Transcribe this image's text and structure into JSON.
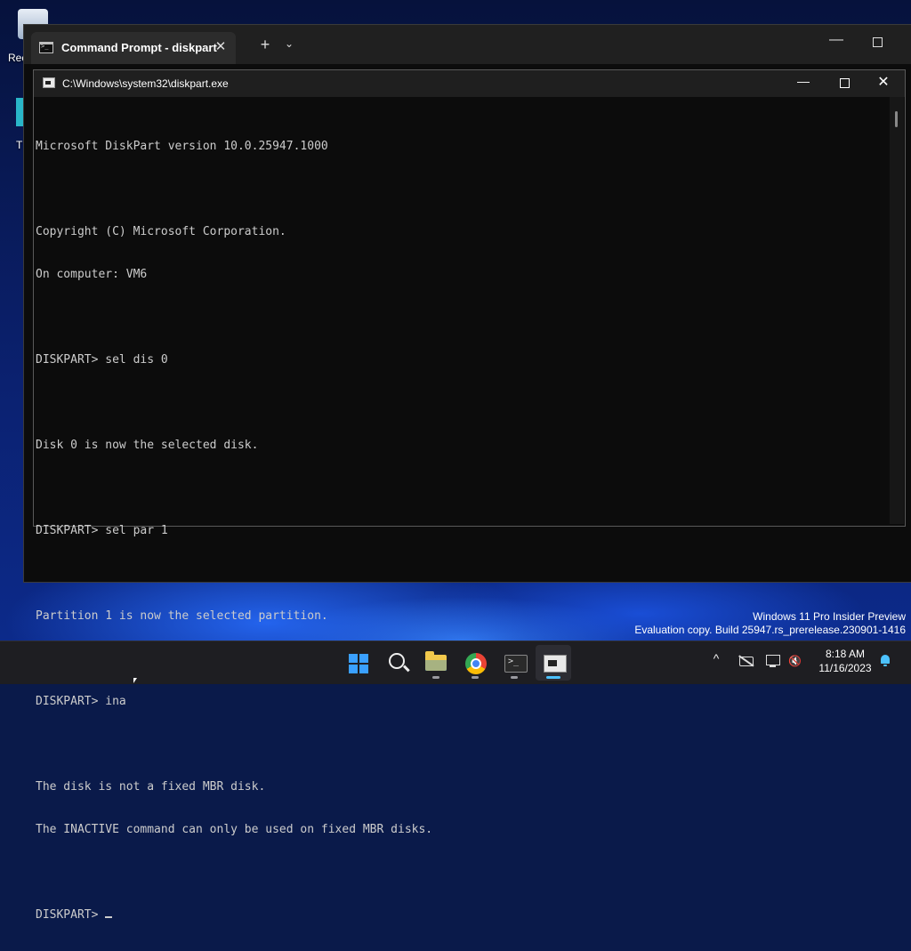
{
  "desktop": {
    "recycle_label": "Rec",
    "icon2_label": "T"
  },
  "terminal_window": {
    "tab_title": "Command Prompt - diskpart",
    "tab_close": "✕",
    "new_tab": "+",
    "dropdown": "⌄",
    "minimize": "—"
  },
  "conhost_window": {
    "title": "C:\\Windows\\system32\\diskpart.exe",
    "minimize": "—",
    "close": "✕"
  },
  "console": {
    "lines": [
      "Microsoft DiskPart version 10.0.25947.1000",
      "",
      "Copyright (C) Microsoft Corporation.",
      "On computer: VM6",
      "",
      "DISKPART> sel dis 0",
      "",
      "Disk 0 is now the selected disk.",
      "",
      "DISKPART> sel par 1",
      "",
      "Partition 1 is now the selected partition.",
      "",
      "DISKPART> ina",
      "",
      "The disk is not a fixed MBR disk.",
      "The INACTIVE command can only be used on fixed MBR disks.",
      ""
    ],
    "prompt": "DISKPART> "
  },
  "watermark": {
    "line1": "Windows 11 Pro Insider Preview",
    "line2": "Evaluation copy. Build 25947.rs_prerelease.230901-1416"
  },
  "taskbar": {
    "apps": [
      {
        "name": "start",
        "icon": "windows-logo-icon"
      },
      {
        "name": "search",
        "icon": "search-icon"
      },
      {
        "name": "file-explorer",
        "icon": "folder-icon"
      },
      {
        "name": "chrome",
        "icon": "chrome-icon"
      },
      {
        "name": "terminal",
        "icon": "terminal-icon"
      },
      {
        "name": "console-host",
        "icon": "console-window-icon"
      }
    ],
    "tray_chevron": "^",
    "clock_time": "8:18 AM",
    "clock_date": "11/16/2023"
  },
  "colors": {
    "console_text": "#cccccc",
    "console_bg": "#0c0c0c",
    "accent": "#4cc2ff"
  }
}
